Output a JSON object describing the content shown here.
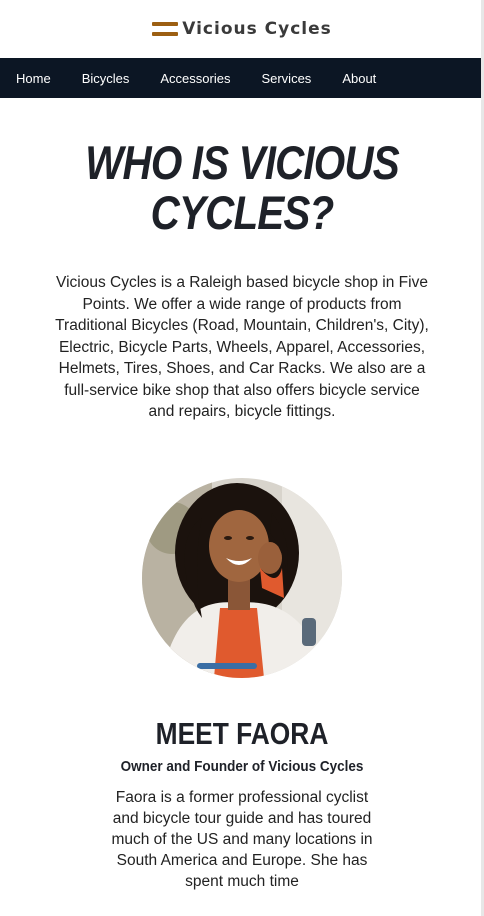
{
  "brand": {
    "name": "Vicious Cycles",
    "accent": "#9c5f12"
  },
  "nav": {
    "background": "#0c1624",
    "items": [
      {
        "label": "Home"
      },
      {
        "label": "Bicycles"
      },
      {
        "label": "Accessories"
      },
      {
        "label": "Services"
      },
      {
        "label": "About"
      }
    ]
  },
  "hero": {
    "title": "WHO IS VICIOUS CYCLES?",
    "intro": "Vicious Cycles is a Raleigh based bicycle shop in Five Points. We offer a wide range of products from Traditional Bicycles (Road, Mountain, Children's, City), Electric, Bicycle Parts, Wheels, Apparel, Accessories, Helmets, Tires, Shoes, and Car Racks. We also are a full-service bike shop that also offers bicycle service and repairs, bicycle fittings."
  },
  "owner": {
    "photo_icon": "owner-portrait",
    "title": "MEET FAORA",
    "subtitle": "Owner and Founder of Vicious Cycles",
    "bio": "Faora is a former professional cyclist and bicycle tour guide and has toured much of the US and many locations in South America and Europe. She has spent much time"
  }
}
